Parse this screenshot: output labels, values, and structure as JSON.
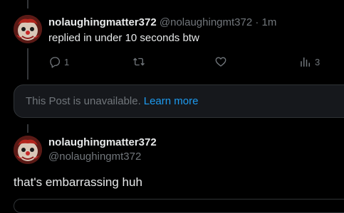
{
  "post_1": {
    "display_name": "nolaughingmatter372",
    "handle": "@nolaughingmt372",
    "separator": "·",
    "time": "1m",
    "text": "replied in under 10 seconds btw",
    "actions": {
      "reply_count": "1",
      "repost_count": "",
      "like_count": "",
      "views_count": "3"
    }
  },
  "quoted": {
    "message": "This Post is unavailable.",
    "link_label": "Learn more"
  },
  "post_2": {
    "display_name": "nolaughingmatter372",
    "handle": "@nolaughingmt372",
    "text": "that's embarrassing huh"
  },
  "icons": {
    "reply": "reply-icon",
    "repost": "repost-icon",
    "like": "heart-icon",
    "views": "views-icon"
  },
  "colors": {
    "background": "#000000",
    "primary_text": "#e7e9ea",
    "secondary_text": "#71767b",
    "link": "#1d9bf0",
    "card_bg": "#16181c",
    "border": "#2f3336"
  }
}
